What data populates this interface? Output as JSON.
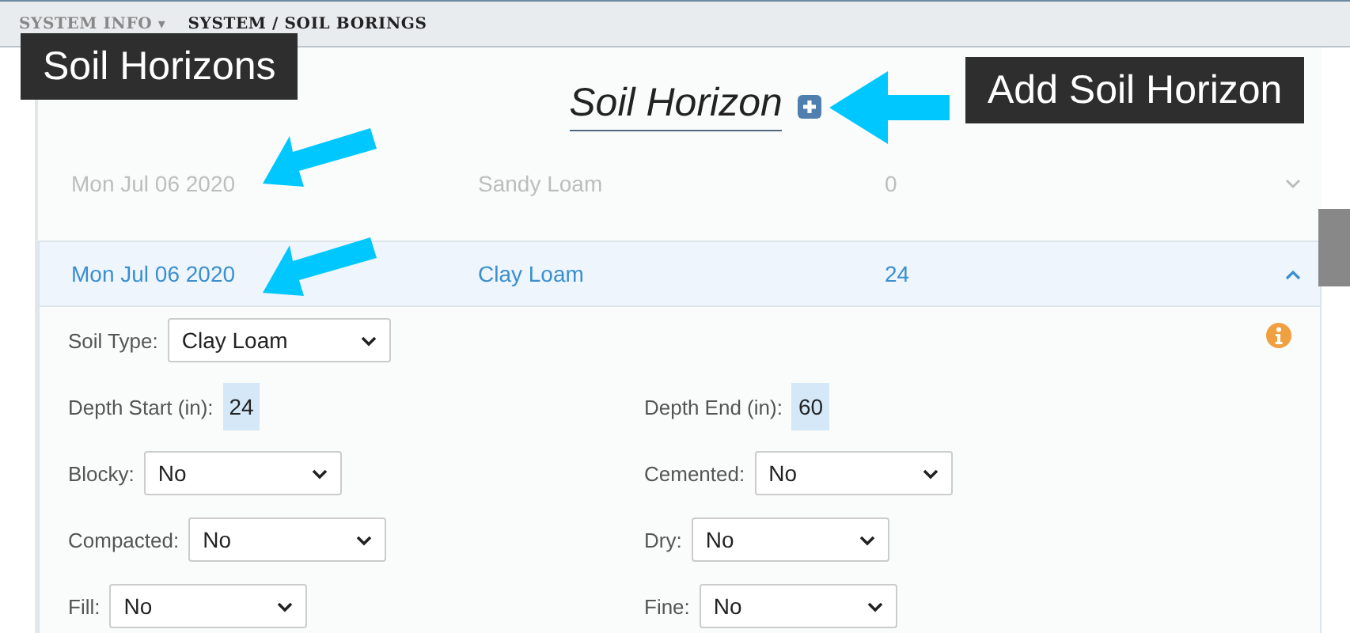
{
  "breadcrumb": {
    "menu": "SYSTEM INFO",
    "menu_caret": "▾",
    "path": "SYSTEM / SOIL BORINGS"
  },
  "heading": "Soil Horizon",
  "callouts": [
    {
      "text": "Soil Horizons"
    },
    {
      "text": "Add Soil Horizon"
    }
  ],
  "horizons": [
    {
      "date": "Mon Jul 06 2020",
      "soil_type": "Sandy Loam",
      "depth": "0",
      "expanded": false
    },
    {
      "date": "Mon Jul 06 2020",
      "soil_type": "Clay Loam",
      "depth": "24",
      "expanded": true
    }
  ],
  "form": {
    "rows": [
      [
        {
          "label": "Soil Type:",
          "kind": "select",
          "value": "Clay Loam"
        }
      ],
      [
        {
          "label": "Depth Start (in):",
          "kind": "value",
          "value": "24"
        },
        {
          "label": "Depth End (in):",
          "kind": "value",
          "value": "60"
        }
      ],
      [
        {
          "label": "Blocky:",
          "kind": "select",
          "value": "No"
        },
        {
          "label": "Cemented:",
          "kind": "select",
          "value": "No"
        }
      ],
      [
        {
          "label": "Compacted:",
          "kind": "select",
          "value": "No"
        },
        {
          "label": "Dry:",
          "kind": "select",
          "value": "No"
        }
      ],
      [
        {
          "label": "Fill:",
          "kind": "select",
          "value": "No"
        },
        {
          "label": "Fine:",
          "kind": "select",
          "value": "No"
        }
      ]
    ]
  }
}
